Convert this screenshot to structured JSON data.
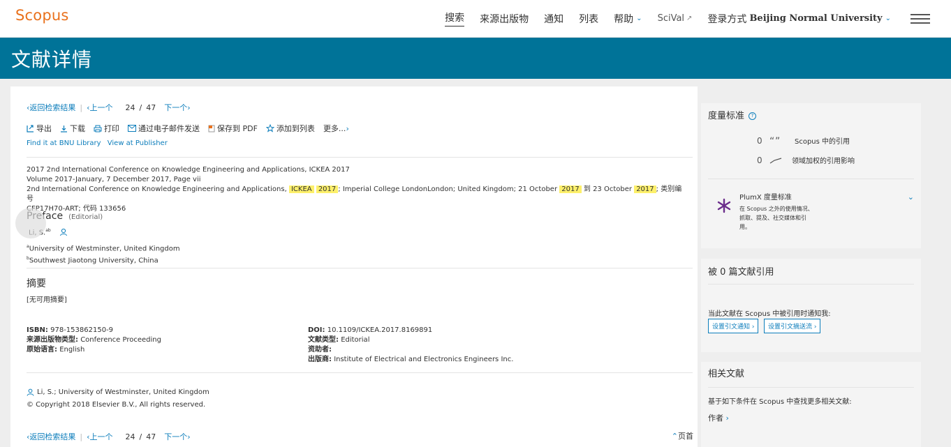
{
  "app": {
    "logo": "Scopus"
  },
  "nav": {
    "search": "搜索",
    "sources": "来源出版物",
    "alerts": "通知",
    "lists": "列表",
    "help": "帮助",
    "scival": "SciVal",
    "login_prefix": "登录方式",
    "institution": "Beijing Normal University"
  },
  "page": {
    "heading": "文献详情"
  },
  "pager": {
    "back": "返回检索结果",
    "prev": "上一个",
    "current": "24",
    "slash": "/",
    "total": "47",
    "next": "下一个"
  },
  "toolbar": {
    "export": "导出",
    "download": "下载",
    "print": "打印",
    "email": "通过电子邮件发送",
    "pdf": "保存到 PDF",
    "add_list": "添加到列表",
    "more": "更多..."
  },
  "links": {
    "library": "Find it at BNU Library",
    "publisher": "View at Publisher"
  },
  "conference": {
    "line1": "2017 2nd International Conference on Knowledge Engineering and Applications, ICKEA 2017",
    "line2": "Volume 2017-January, 7 December 2017, Page vii",
    "line3_a": "2nd International Conference on Knowledge Engineering and Applications,",
    "hl1": "ICKEA",
    "hl2": "2017",
    "line3_b": "; Imperial College LondonLondon; United Kingdom; 21 October",
    "hl3": "2017",
    "line3_c": "到 23 October",
    "hl4": "2017",
    "line3_d": "; 类别编号",
    "line4": "CFP17H70-ART; 代码 133656"
  },
  "document": {
    "title": "Preface",
    "type": "(Editorial)",
    "author": "Li, S.",
    "author_sup": "ab",
    "affil_a_sup": "a",
    "affil_a": "University of Westminster, United Kingdom",
    "affil_b_sup": "b",
    "affil_b": "Southwest Jiaotong University, China"
  },
  "abstract": {
    "heading": "摘要",
    "text": "[无可用摘要]"
  },
  "meta": {
    "isbn_label": "ISBN:",
    "isbn": "978-153862150-9",
    "source_type_label": "来源出版物类型:",
    "source_type": "Conference Proceeding",
    "lang_label": "原始语言:",
    "lang": "English",
    "doi_label": "DOI:",
    "doi": "10.1109/ICKEA.2017.8169891",
    "doc_type_label": "文献类型:",
    "doc_type": "Editorial",
    "sponsor_label": "资助者:",
    "sponsor": "",
    "publisher_label": "出版商:",
    "publisher": "Institute of Electrical and Electronics Engineers Inc."
  },
  "footer": {
    "author_info": "Li, S.; University of Westminster, United Kingdom",
    "copyright": "© Copyright 2018 Elsevier B.V., All rights reserved.",
    "top": "页首"
  },
  "metrics": {
    "heading": "度量标准",
    "help": "?",
    "citations_num": "0",
    "citations_label": "Scopus 中的引用",
    "fwci_num": "0",
    "fwci_label": "领域加权的引用影响",
    "plumx_title": "PlumX 度量标准",
    "plumx_desc1": "在 Scopus 之外的使用情况、",
    "plumx_desc2": "抓取、提及、社交媒体和引",
    "plumx_desc3": "用。"
  },
  "cited_by": {
    "heading": "被 0 篇文献引用",
    "notify": "当此文献在 Scopus 中被引用时通知我:",
    "alert_btn": "设置引文通知",
    "feed_btn": "设置引文摘送流"
  },
  "related": {
    "heading": "相关文献",
    "text": "基于如下条件在 Scopus 中查找更多相关文献:",
    "authors_link": "作者"
  },
  "colors": {
    "brand": "#e9711c",
    "band": "#007398",
    "link": "#0c7dbb",
    "highlight": "#fdf06b"
  }
}
